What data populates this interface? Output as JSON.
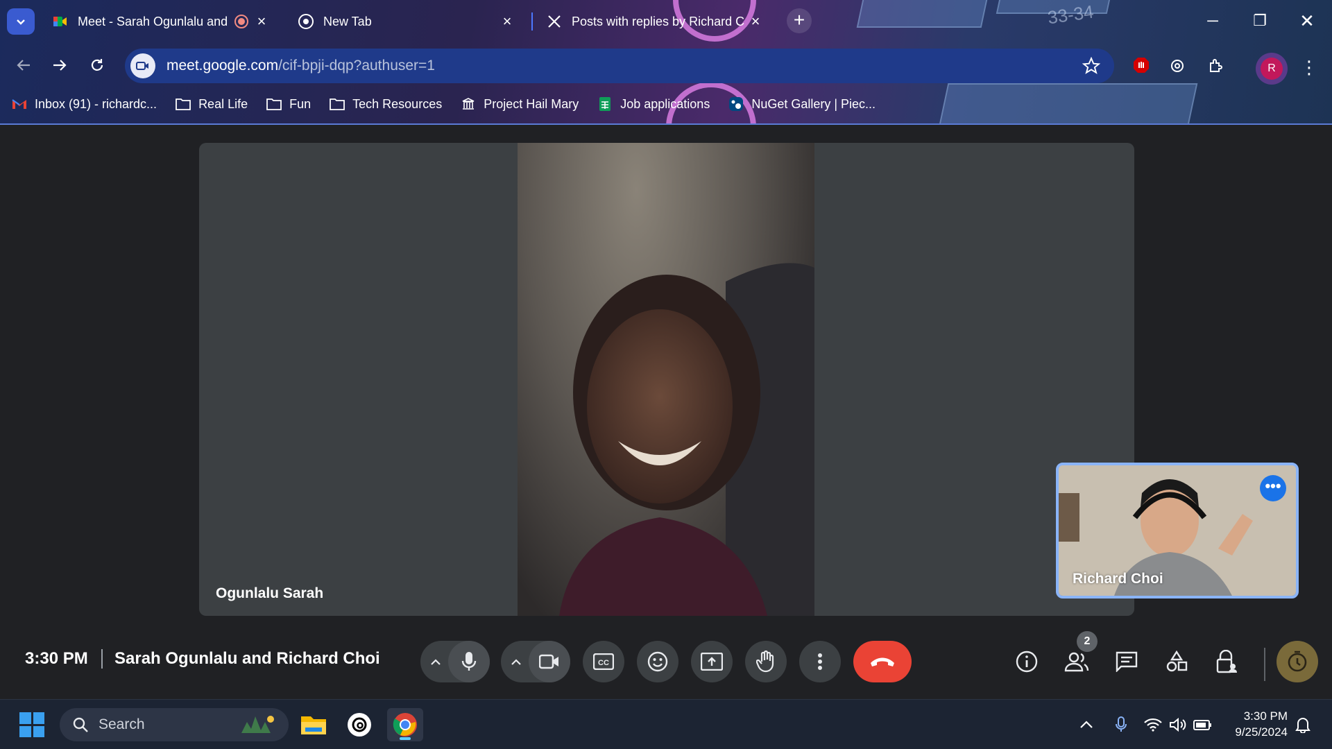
{
  "browser": {
    "tabs": [
      {
        "title": "Meet - Sarah Ogunlalu and",
        "active": true
      },
      {
        "title": "New Tab",
        "active": false
      },
      {
        "title": "Posts with replies by Richard Ch",
        "active": false
      }
    ],
    "url_domain": "meet.google.com",
    "url_path": "/cif-bpji-dqp?authuser=1",
    "profile_initial": "R",
    "bookmarks": [
      {
        "label": "Inbox (91) - richardc...",
        "icon": "gmail-icon"
      },
      {
        "label": "Real Life",
        "icon": "folder-icon"
      },
      {
        "label": "Fun",
        "icon": "folder-icon"
      },
      {
        "label": "Tech Resources",
        "icon": "folder-icon"
      },
      {
        "label": "Project Hail Mary",
        "icon": "library-icon"
      },
      {
        "label": "Job applications",
        "icon": "sheets-icon"
      },
      {
        "label": "NuGet Gallery | Piec...",
        "icon": "nuget-icon"
      }
    ]
  },
  "meet": {
    "main_participant": "Ogunlalu Sarah",
    "self_participant": "Richard Choi",
    "time": "3:30 PM",
    "title": "Sarah Ogunlalu and Richard Choi",
    "people_count": "2",
    "controls": [
      "mic-button",
      "camera-button",
      "captions-button",
      "reactions-button",
      "present-button",
      "raise-hand-button",
      "more-options-button",
      "leave-call-button"
    ],
    "side_controls": [
      "meeting-details-button",
      "people-button",
      "chat-button",
      "activities-button",
      "host-controls-button"
    ]
  },
  "taskbar": {
    "search_label": "Search",
    "clock_time": "3:30 PM",
    "clock_date": "9/25/2024"
  },
  "colors": {
    "accent_blue": "#1a73e8",
    "end_call_red": "#ea4335",
    "meet_bg": "#202124",
    "tile_bg": "#3c4043"
  }
}
